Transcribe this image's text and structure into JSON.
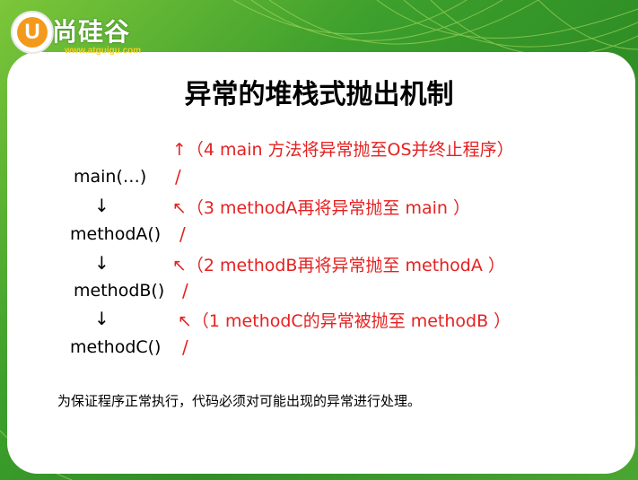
{
  "logo": {
    "badge_letter": "U",
    "name": "尚硅谷",
    "url": "www.atguigu.com"
  },
  "title": "异常的堆栈式抛出机制",
  "stack": {
    "main": "main(…)",
    "methodA": "methodA()",
    "methodB": "methodB()",
    "methodC": "methodC()",
    "down_arrow": "↓",
    "slash": "/"
  },
  "annotations": {
    "step4": "↑（4 main 方法将异常抛至OS并终止程序）",
    "step3": "↖（3 methodA再将异常抛至 main ）",
    "step2": "↖（2 methodB再将异常抛至 methodA ）",
    "step1": "↖（1 methodC的异常被抛至 methodB ）"
  },
  "note": "为保证程序正常执行，代码必须对可能出现的异常进行处理。",
  "colors": {
    "background_green": "#3d9f2c",
    "annotation_red": "#e52121",
    "logo_orange": "#f39a1d",
    "url_yellow": "#f5d020"
  }
}
